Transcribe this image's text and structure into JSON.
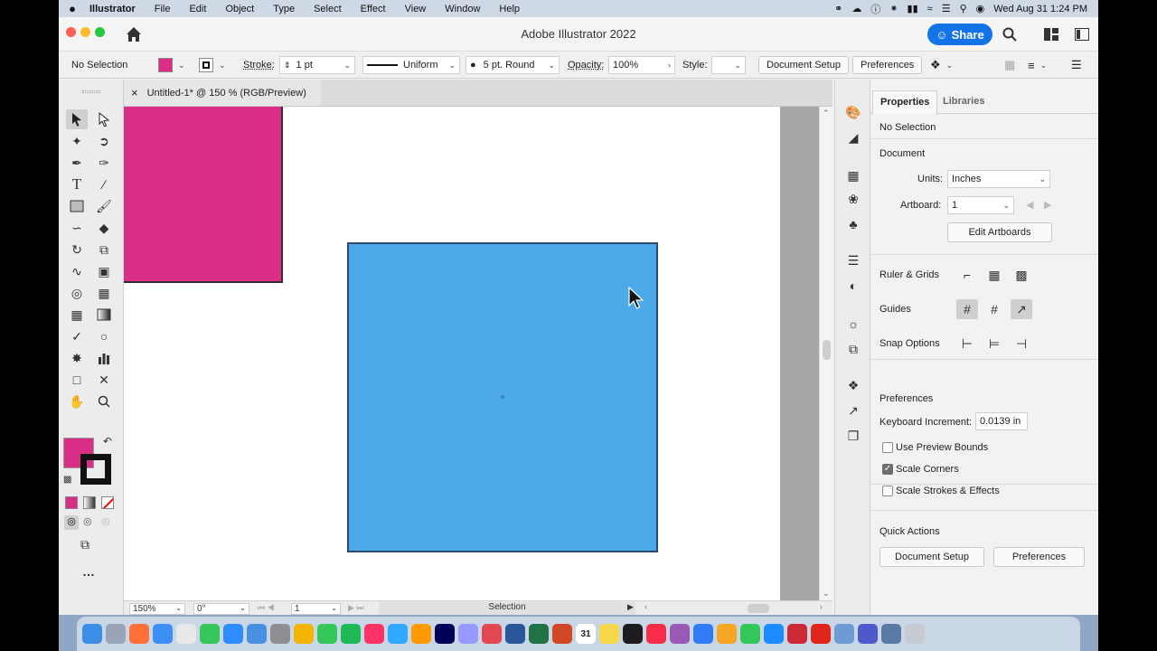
{
  "menubar": {
    "apple": "",
    "app": "Illustrator",
    "items": [
      "File",
      "Edit",
      "Object",
      "Type",
      "Select",
      "Effect",
      "View",
      "Window",
      "Help"
    ],
    "clock": "Wed Aug 31  1:24 PM"
  },
  "window": {
    "title": "Adobe Illustrator 2022",
    "share_label": "Share"
  },
  "controlbar": {
    "selection": "No Selection",
    "stroke_label": "Stroke:",
    "stroke_value": "1 pt",
    "profile": "Uniform",
    "brush": "5 pt. Round",
    "opacity_label": "Opacity:",
    "opacity_value": "100%",
    "style_label": "Style:",
    "document_setup": "Document Setup",
    "preferences": "Preferences",
    "fill_color": "#d92e86",
    "stroke_color": "#111111"
  },
  "document": {
    "tab_title": "Untitled-1* @ 150 % (RGB/Preview)",
    "close": "×"
  },
  "canvas": {
    "pink_fill": "#d92e86",
    "blue_fill": "#4ea9e8",
    "blue_stroke": "#2c4a70"
  },
  "statusbar": {
    "zoom": "150%",
    "rotation": "0°",
    "artboard": "1",
    "tool": "Selection"
  },
  "properties": {
    "tab_properties": "Properties",
    "tab_libraries": "Libraries",
    "no_selection": "No Selection",
    "document_heading": "Document",
    "units_label": "Units:",
    "units_value": "Inches",
    "artboard_label": "Artboard:",
    "artboard_value": "1",
    "edit_artboards": "Edit Artboards",
    "ruler_grids": "Ruler & Grids",
    "guides": "Guides",
    "snap_options": "Snap Options",
    "preferences_heading": "Preferences",
    "keyboard_increment_label": "Keyboard Increment:",
    "keyboard_increment_value": "0.0139 in",
    "use_preview_bounds": "Use Preview Bounds",
    "scale_corners": "Scale Corners",
    "scale_strokes": "Scale Strokes & Effects",
    "quick_actions": "Quick Actions",
    "qa_document_setup": "Document Setup",
    "qa_preferences": "Preferences"
  },
  "dock": {
    "items": [
      "Finder",
      "Launchpad",
      "Firefox",
      "Safari",
      "Chrome",
      "Messages",
      "Zoom",
      "Mail",
      "Settings",
      "Photos",
      "FaceTime",
      "Spotify",
      "InDesign",
      "Photoshop",
      "Illustrator",
      "Animate",
      "Premiere",
      "Creative Cloud",
      "Word",
      "Excel",
      "PowerPoint",
      "Calendar",
      "Notes",
      "TV",
      "Music",
      "Podcasts",
      "Keynote",
      "Pages",
      "Numbers",
      "App Store",
      "Zotero",
      "Acrobat",
      "Preview",
      "Teams",
      "Downloads",
      "Trash"
    ],
    "calendar_day": "31"
  }
}
